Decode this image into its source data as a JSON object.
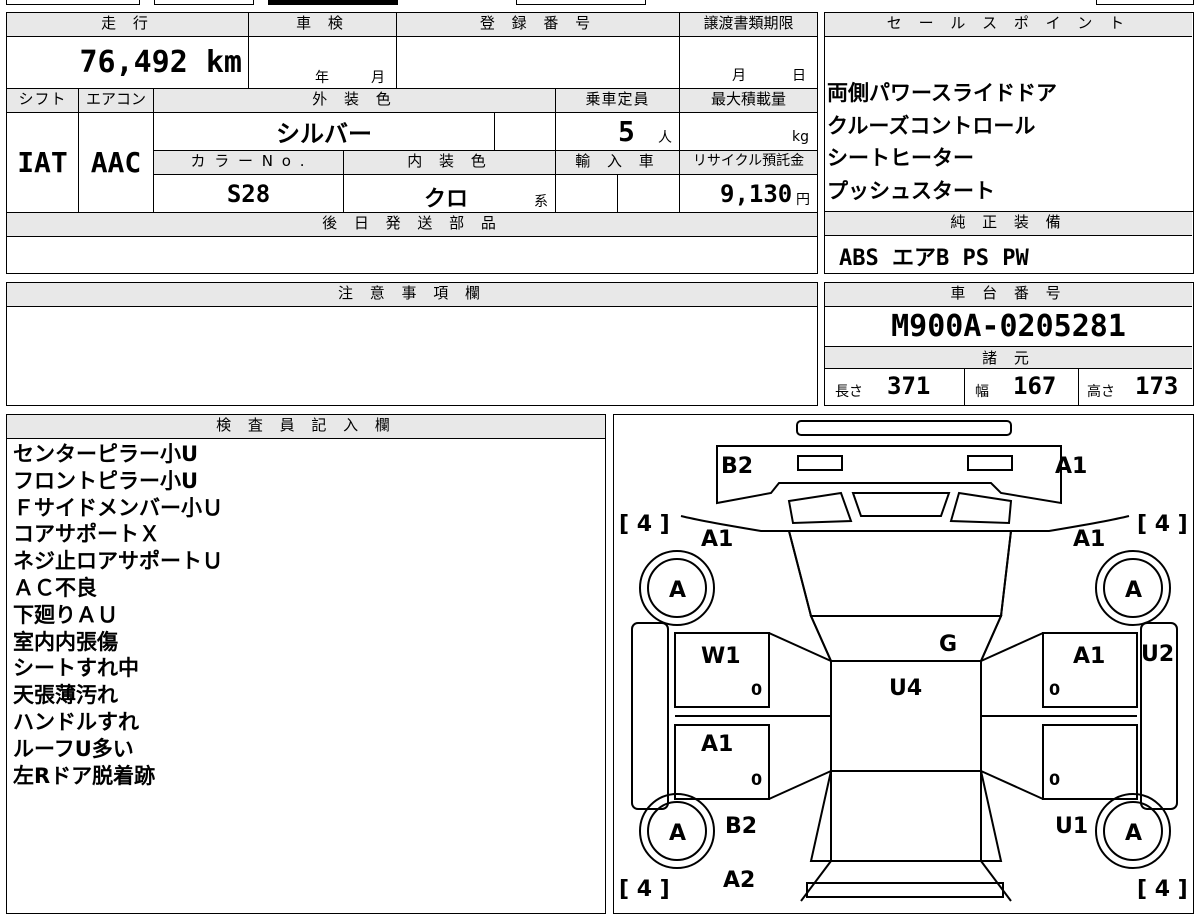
{
  "top_left": {
    "mileage_header": "走 行",
    "mileage": "76,492 km",
    "inspection_header": "車 検",
    "inspection_year_unit": "年",
    "inspection_month_unit": "月",
    "registration_header": "登 録 番 号",
    "transfer_header": "譲渡書類期限",
    "transfer_month_unit": "月",
    "transfer_day_unit": "日",
    "shift_header": "シフト",
    "aircon_header": "エアコン",
    "exterior_header": "外 装 色",
    "capacity_header": "乗車定員",
    "maxload_header": "最大積載量",
    "shift": "IAT",
    "aircon": "AAC",
    "exterior_color": "シルバー",
    "capacity": "5",
    "capacity_unit": "人",
    "maxload_unit": "kg",
    "colorno_header": "カ ラ ー N o .",
    "interior_header": "内 装 色",
    "import_header": "輸 入 車",
    "recycle_header": "リサイクル預託金",
    "color_no": "S28",
    "interior_color": "クロ",
    "interior_suffix": "系",
    "recycle_fee": "9,130",
    "recycle_unit": "円",
    "later_parts_header": "後 日 発 送 部 品"
  },
  "sales_points": {
    "header": "セ ー ル ス ポ イ ン ト",
    "items": [
      "両側パワースライドドア",
      "クルーズコントロール",
      "シートヒーター",
      "プッシュスタート"
    ]
  },
  "genuine_equipment": {
    "header": "純 正 装 備",
    "value": "ABS エアB PS PW"
  },
  "notes": {
    "header": "注 意 事 項 欄"
  },
  "chassis": {
    "header": "車 台 番 号",
    "number": "M900A-0205281",
    "spec_header": "諸 元",
    "length_label": "長さ",
    "length": "371",
    "width_label": "幅",
    "width": "167",
    "height_label": "高さ",
    "height": "173"
  },
  "inspector": {
    "header": "検 査 員 記 入 欄",
    "lines": [
      "センターピラー小U",
      "フロントピラー小U",
      "Ｆサイドメンバー小Ｕ",
      "コアサポートＸ",
      "ネジ止ロアサポートＵ",
      "ＡＣ不良",
      "下廻りＡＵ",
      "室内内張傷",
      "シートすれ中",
      "天張薄汚れ",
      "ハンドルすれ",
      "ルーフU多い",
      "左Rドア脱着跡"
    ]
  },
  "diagram": {
    "labels": {
      "b2_top": "B2",
      "a1_top": "A1",
      "tread_tl": "[ 4 ]",
      "tread_tr": "[ 4 ]",
      "tread_bl": "[ 4 ]",
      "tread_br": "[ 4 ]",
      "a1_fl": "A1",
      "a1_fr": "A1",
      "tire_fl": "A",
      "tire_fr": "A",
      "tire_rl": "A",
      "tire_rr": "A",
      "g": "G",
      "w1": "W1",
      "u4": "U4",
      "a1_rdoor": "A1",
      "u2": "U2",
      "zero_1": "0",
      "zero_2": "0",
      "zero_3": "0",
      "zero_4": "0",
      "a1_ldoor2": "A1",
      "b2_bottom": "B2",
      "u1": "U1",
      "a2": "A2"
    }
  }
}
